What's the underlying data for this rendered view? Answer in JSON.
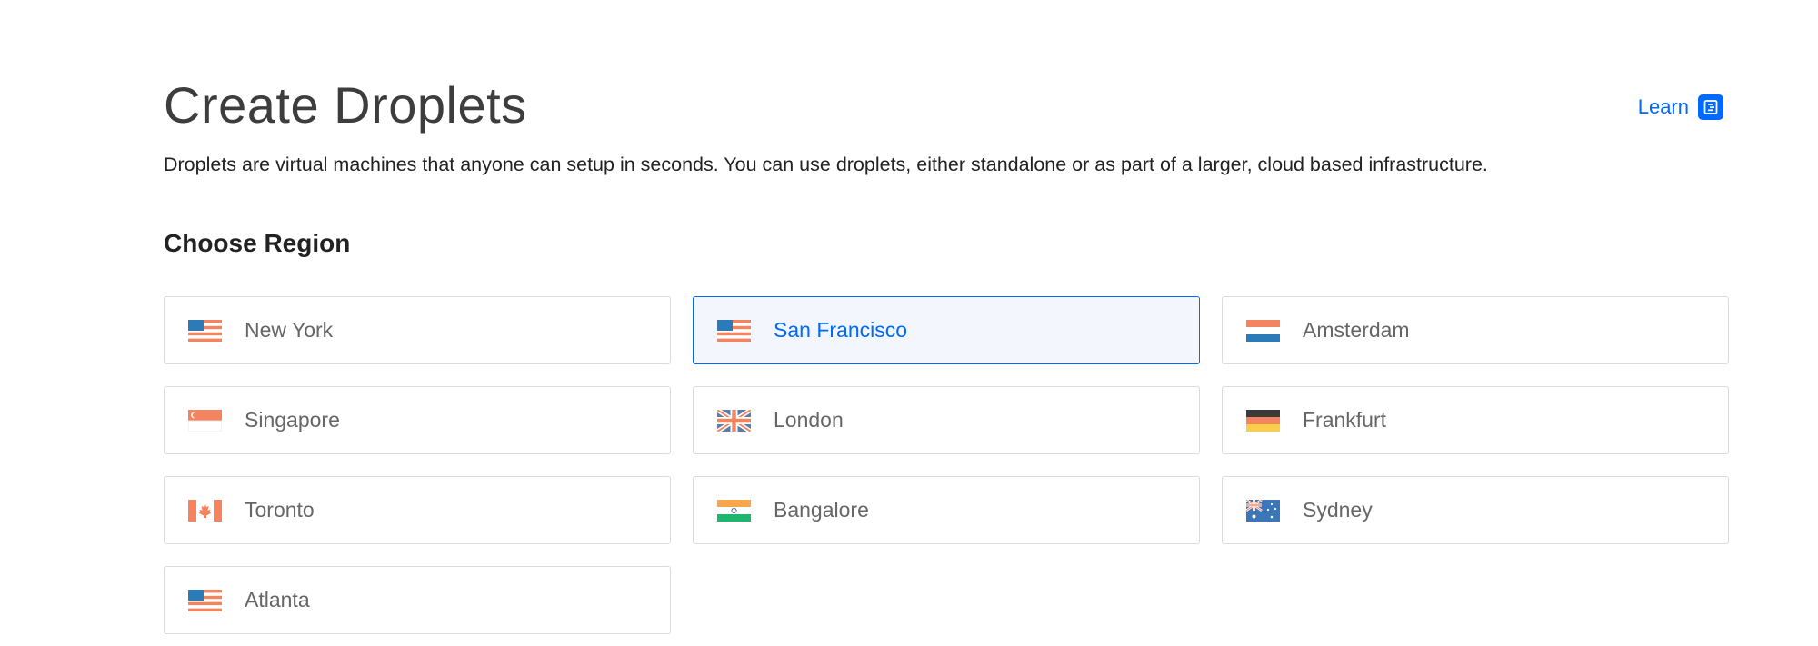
{
  "header": {
    "title": "Create Droplets",
    "learn_label": "Learn",
    "description": "Droplets are virtual machines that anyone can setup in seconds. You can use droplets, either standalone or as part of a larger, cloud based infrastructure."
  },
  "section": {
    "title": "Choose Region"
  },
  "regions": [
    {
      "label": "New York",
      "flag": "us-flag-icon",
      "selected": false
    },
    {
      "label": "San Francisco",
      "flag": "us-flag-icon",
      "selected": true
    },
    {
      "label": "Amsterdam",
      "flag": "nl-flag-icon",
      "selected": false
    },
    {
      "label": "Singapore",
      "flag": "sg-flag-icon",
      "selected": false
    },
    {
      "label": "London",
      "flag": "uk-flag-icon",
      "selected": false
    },
    {
      "label": "Frankfurt",
      "flag": "de-flag-icon",
      "selected": false
    },
    {
      "label": "Toronto",
      "flag": "ca-flag-icon",
      "selected": false
    },
    {
      "label": "Bangalore",
      "flag": "in-flag-icon",
      "selected": false
    },
    {
      "label": "Sydney",
      "flag": "au-flag-icon",
      "selected": false
    },
    {
      "label": "Atlanta",
      "flag": "us-flag-icon",
      "selected": false
    }
  ],
  "colors": {
    "accent": "#0069ff",
    "selected_bg": "#f3f7fd",
    "border": "#dcdcdc"
  }
}
